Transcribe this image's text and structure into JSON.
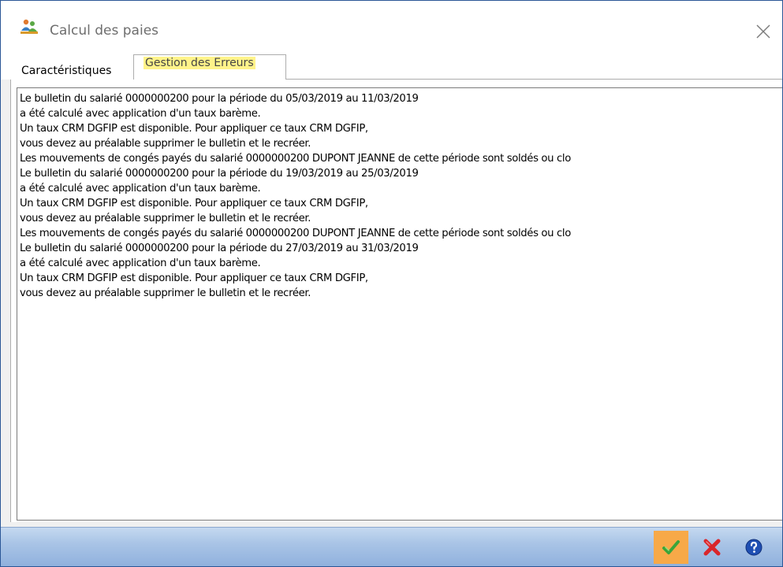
{
  "window": {
    "title": "Calcul des paies",
    "close_glyph": "✕"
  },
  "icons": {
    "app": "payroll-people-icon",
    "close": "close-icon",
    "validate": "checkmark-icon",
    "cancel": "red-cross-icon",
    "help": "help-question-icon"
  },
  "tabs": [
    {
      "label": "Caractéristiques",
      "active": false
    },
    {
      "label": "Gestion des Erreurs",
      "active": true,
      "highlight": "#fff38a"
    }
  ],
  "errors": {
    "lines": [
      "Le bulletin du salarié 0000000200 pour la période du 05/03/2019 au 11/03/2019",
      "a été calculé avec application d'un taux barème.",
      "Un taux CRM DGFIP est disponible. Pour appliquer ce taux CRM DGFIP,",
      "vous devez au préalable supprimer le bulletin et le recréer.",
      "Les mouvements de congés payés du salarié 0000000200 DUPONT JEANNE de cette période sont soldés ou clo",
      "Le bulletin du salarié 0000000200 pour la période du 19/03/2019 au 25/03/2019",
      "a été calculé avec application d'un taux barème.",
      "Un taux CRM DGFIP est disponible. Pour appliquer ce taux CRM DGFIP,",
      "vous devez au préalable supprimer le bulletin et le recréer.",
      "Les mouvements de congés payés du salarié 0000000200 DUPONT JEANNE de cette période sont soldés ou clo",
      "Le bulletin du salarié 0000000200 pour la période du 27/03/2019 au 31/03/2019",
      "a été calculé avec application d'un taux barème.",
      "Un taux CRM DGFIP est disponible. Pour appliquer ce taux CRM DGFIP,",
      "vous devez au préalable supprimer le bulletin et le recréer."
    ]
  },
  "colors": {
    "window_border": "#2b5797",
    "tab_highlight": "#fff38a",
    "validate_button_bg": "#f7a948",
    "bottom_bar": "#a9c4e6"
  }
}
